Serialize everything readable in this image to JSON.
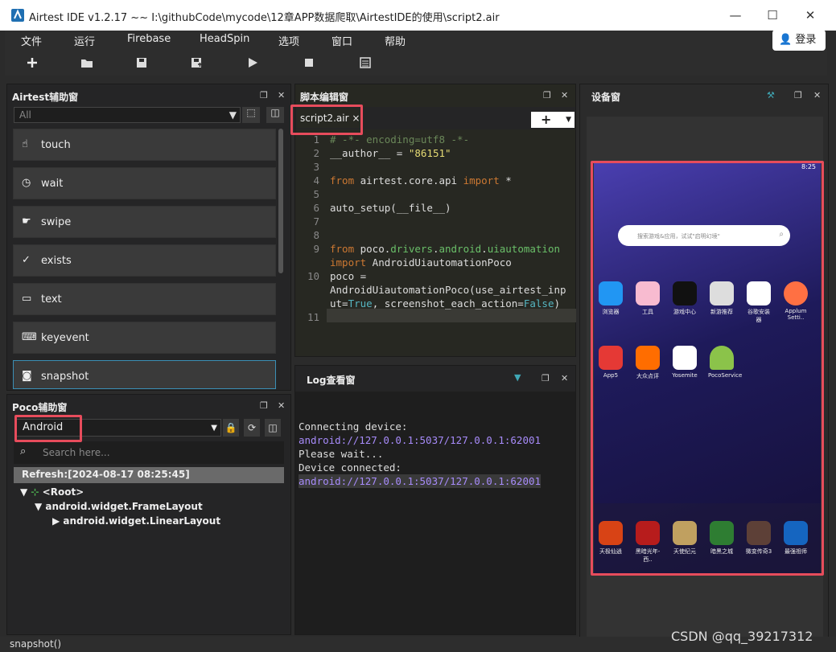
{
  "window": {
    "title": "Airtest IDE v1.2.17 ~~ I:\\githubCode\\mycode\\12章APP数据爬取\\AirtestIDE的使用\\script2.air",
    "min": "—",
    "max": "☐",
    "close": "✕"
  },
  "menu": [
    "文件",
    "运行",
    "Firebase",
    "HeadSpin",
    "选项",
    "窗口",
    "帮助"
  ],
  "login": "登录",
  "airtest_panel": {
    "title": "Airtest辅助窗",
    "filter": "All",
    "items": [
      "touch",
      "wait",
      "swipe",
      "exists",
      "text",
      "keyevent",
      "snapshot"
    ]
  },
  "poco_panel": {
    "title": "Poco辅助窗",
    "mode": "Android",
    "search_placeholder": "Search here...",
    "refresh": "Refresh:[2024-08-17 08:25:45]",
    "tree": [
      "<Root>",
      "android.widget.FrameLayout",
      "android.widget.LinearLayout"
    ]
  },
  "editor": {
    "title": "脚本编辑窗",
    "tab": "script2.air",
    "tab_close": "×",
    "line_numbers": [
      "1",
      "2",
      "3",
      "4",
      "5",
      "6",
      "7",
      "8",
      "9",
      "",
      "10",
      "",
      "11"
    ]
  },
  "log_panel": {
    "title": "Log查看窗",
    "lines": [
      "Connecting device:",
      "android://127.0.0.1:5037/127.0.0.1:62001",
      "Please wait...",
      "Device connected:",
      "android://127.0.0.1:5037/127.0.0.1:62001"
    ]
  },
  "device_panel": {
    "title": "设备窗",
    "time": "8:25",
    "search_hint": "搜索游戏&应用，试试\"启明幻境\"",
    "apps_row1": [
      "浏览器",
      "工具",
      "游戏中心",
      "新游推荐",
      "谷歌安装器",
      "Applum Setti.."
    ],
    "apps_row2": [
      "App5",
      "大众点评",
      "Yosemite",
      "PocoService"
    ],
    "dock": [
      "天极仙逍",
      "黑暗光年-西..",
      "天使纪元",
      "暗黑之城",
      "微变传奇3",
      "最强祖师"
    ]
  },
  "statusbar": "snapshot()",
  "watermark": "CSDN @qq_39217312",
  "colors": {
    "accent": "#e74c5c",
    "bg": "#2b2b2b"
  }
}
